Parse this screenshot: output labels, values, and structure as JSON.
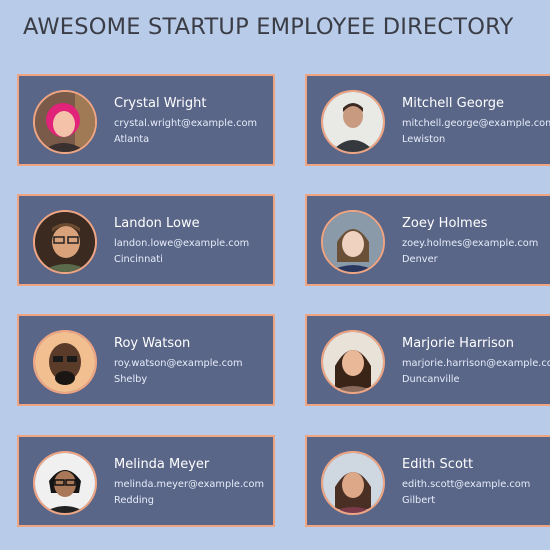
{
  "page": {
    "title": "AWESOME STARTUP EMPLOYEE DIRECTORY"
  },
  "theme": {
    "background": "#b8cbe8",
    "card_bg": "#5a6688",
    "accent_border": "#f0a582",
    "title_color": "#3a3d45"
  },
  "employees": [
    {
      "name": "Crystal Wright",
      "email": "crystal.wright@example.com",
      "city": "Atlanta",
      "photo_icon": "avatar-photo"
    },
    {
      "name": "Mitchell George",
      "email": "mitchell.george@example.com",
      "city": "Lewiston",
      "photo_icon": "avatar-photo"
    },
    {
      "name": "Landon Lowe",
      "email": "landon.lowe@example.com",
      "city": "Cincinnati",
      "photo_icon": "avatar-photo"
    },
    {
      "name": "Zoey Holmes",
      "email": "zoey.holmes@example.com",
      "city": "Denver",
      "photo_icon": "avatar-photo"
    },
    {
      "name": "Roy Watson",
      "email": "roy.watson@example.com",
      "city": "Shelby",
      "photo_icon": "avatar-photo"
    },
    {
      "name": "Marjorie Harrison",
      "email": "marjorie.harrison@example.com",
      "city": "Duncanville",
      "photo_icon": "avatar-photo"
    },
    {
      "name": "Melinda Meyer",
      "email": "melinda.meyer@example.com",
      "city": "Redding",
      "photo_icon": "avatar-photo"
    },
    {
      "name": "Edith Scott",
      "email": "edith.scott@example.com",
      "city": "Gilbert",
      "photo_icon": "avatar-photo"
    }
  ]
}
